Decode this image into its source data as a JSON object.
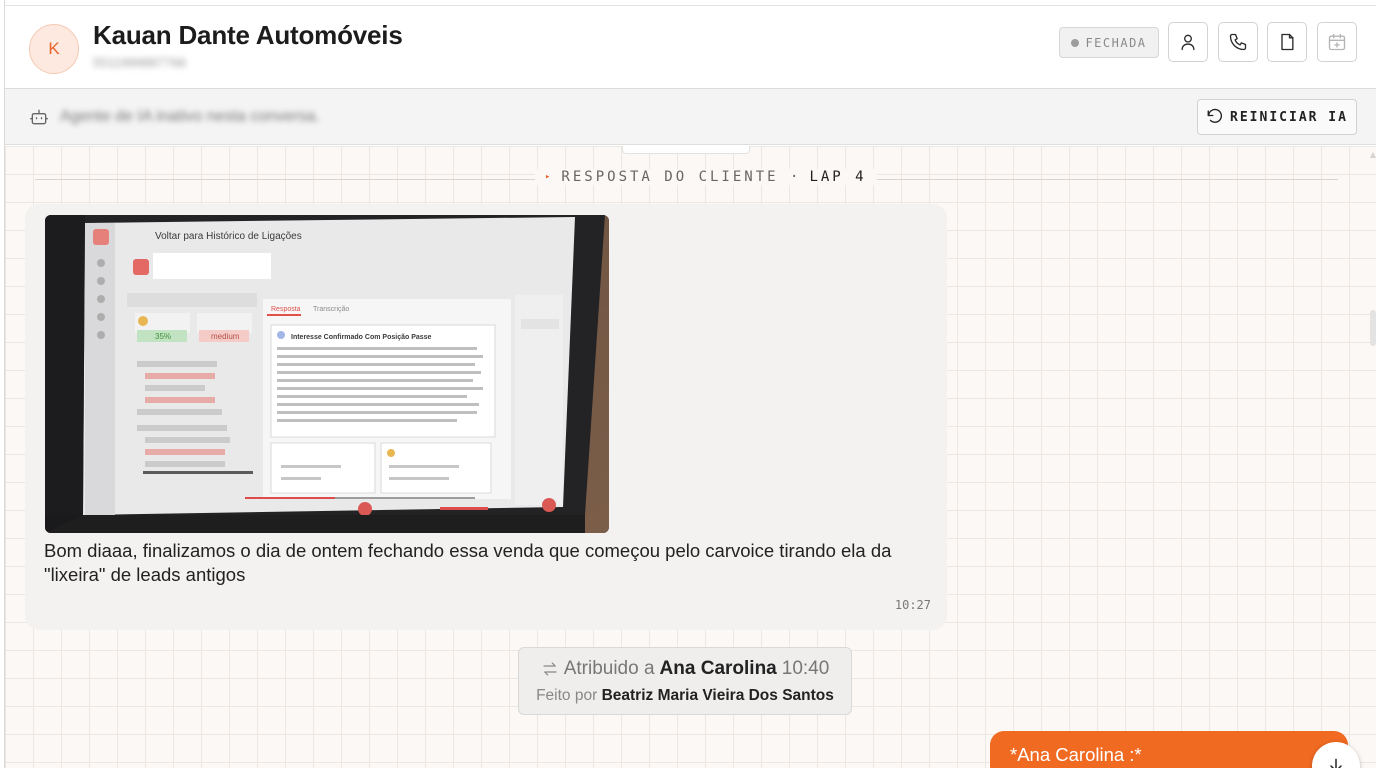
{
  "contact": {
    "avatar_initial": "K",
    "name": "Kauan Dante Automóveis",
    "phone_masked": "5511999887766"
  },
  "header": {
    "status_label": "FECHADA",
    "icons": [
      "user-icon",
      "phone-icon",
      "file-icon",
      "calendar-plus-icon"
    ]
  },
  "ai_bar": {
    "text": "Agente de IA inativo nesta conversa.",
    "reset_label": "REINICIAR IA"
  },
  "divider": {
    "label": "RESPOSTA DO CLIENTE ·",
    "lap": "LAP 4"
  },
  "message": {
    "text": "Bom diaaa, finalizamos o dia de ontem fechando essa venda que começou pelo carvoice tirando ela da \"lixeira\" de leads antigos",
    "time": "10:27",
    "photo": {
      "back_label": "Voltar para Histórico de Ligações",
      "tab_active": "Resposta",
      "tab_other": "Transcrição",
      "card_title": "Interesse Confirmado Com Posição Passe",
      "pct": "35%",
      "level": "medium"
    }
  },
  "assignment": {
    "prefix": "Atribuido a",
    "assignee": "Ana Carolina",
    "time": "10:40",
    "by_prefix": "Feito por",
    "by_name": "Beatriz Maria Vieira Dos Santos"
  },
  "outgoing": {
    "text": "*Ana Carolina :*"
  },
  "colors": {
    "accent": "#f06a22",
    "background": "#fbf8f5"
  }
}
